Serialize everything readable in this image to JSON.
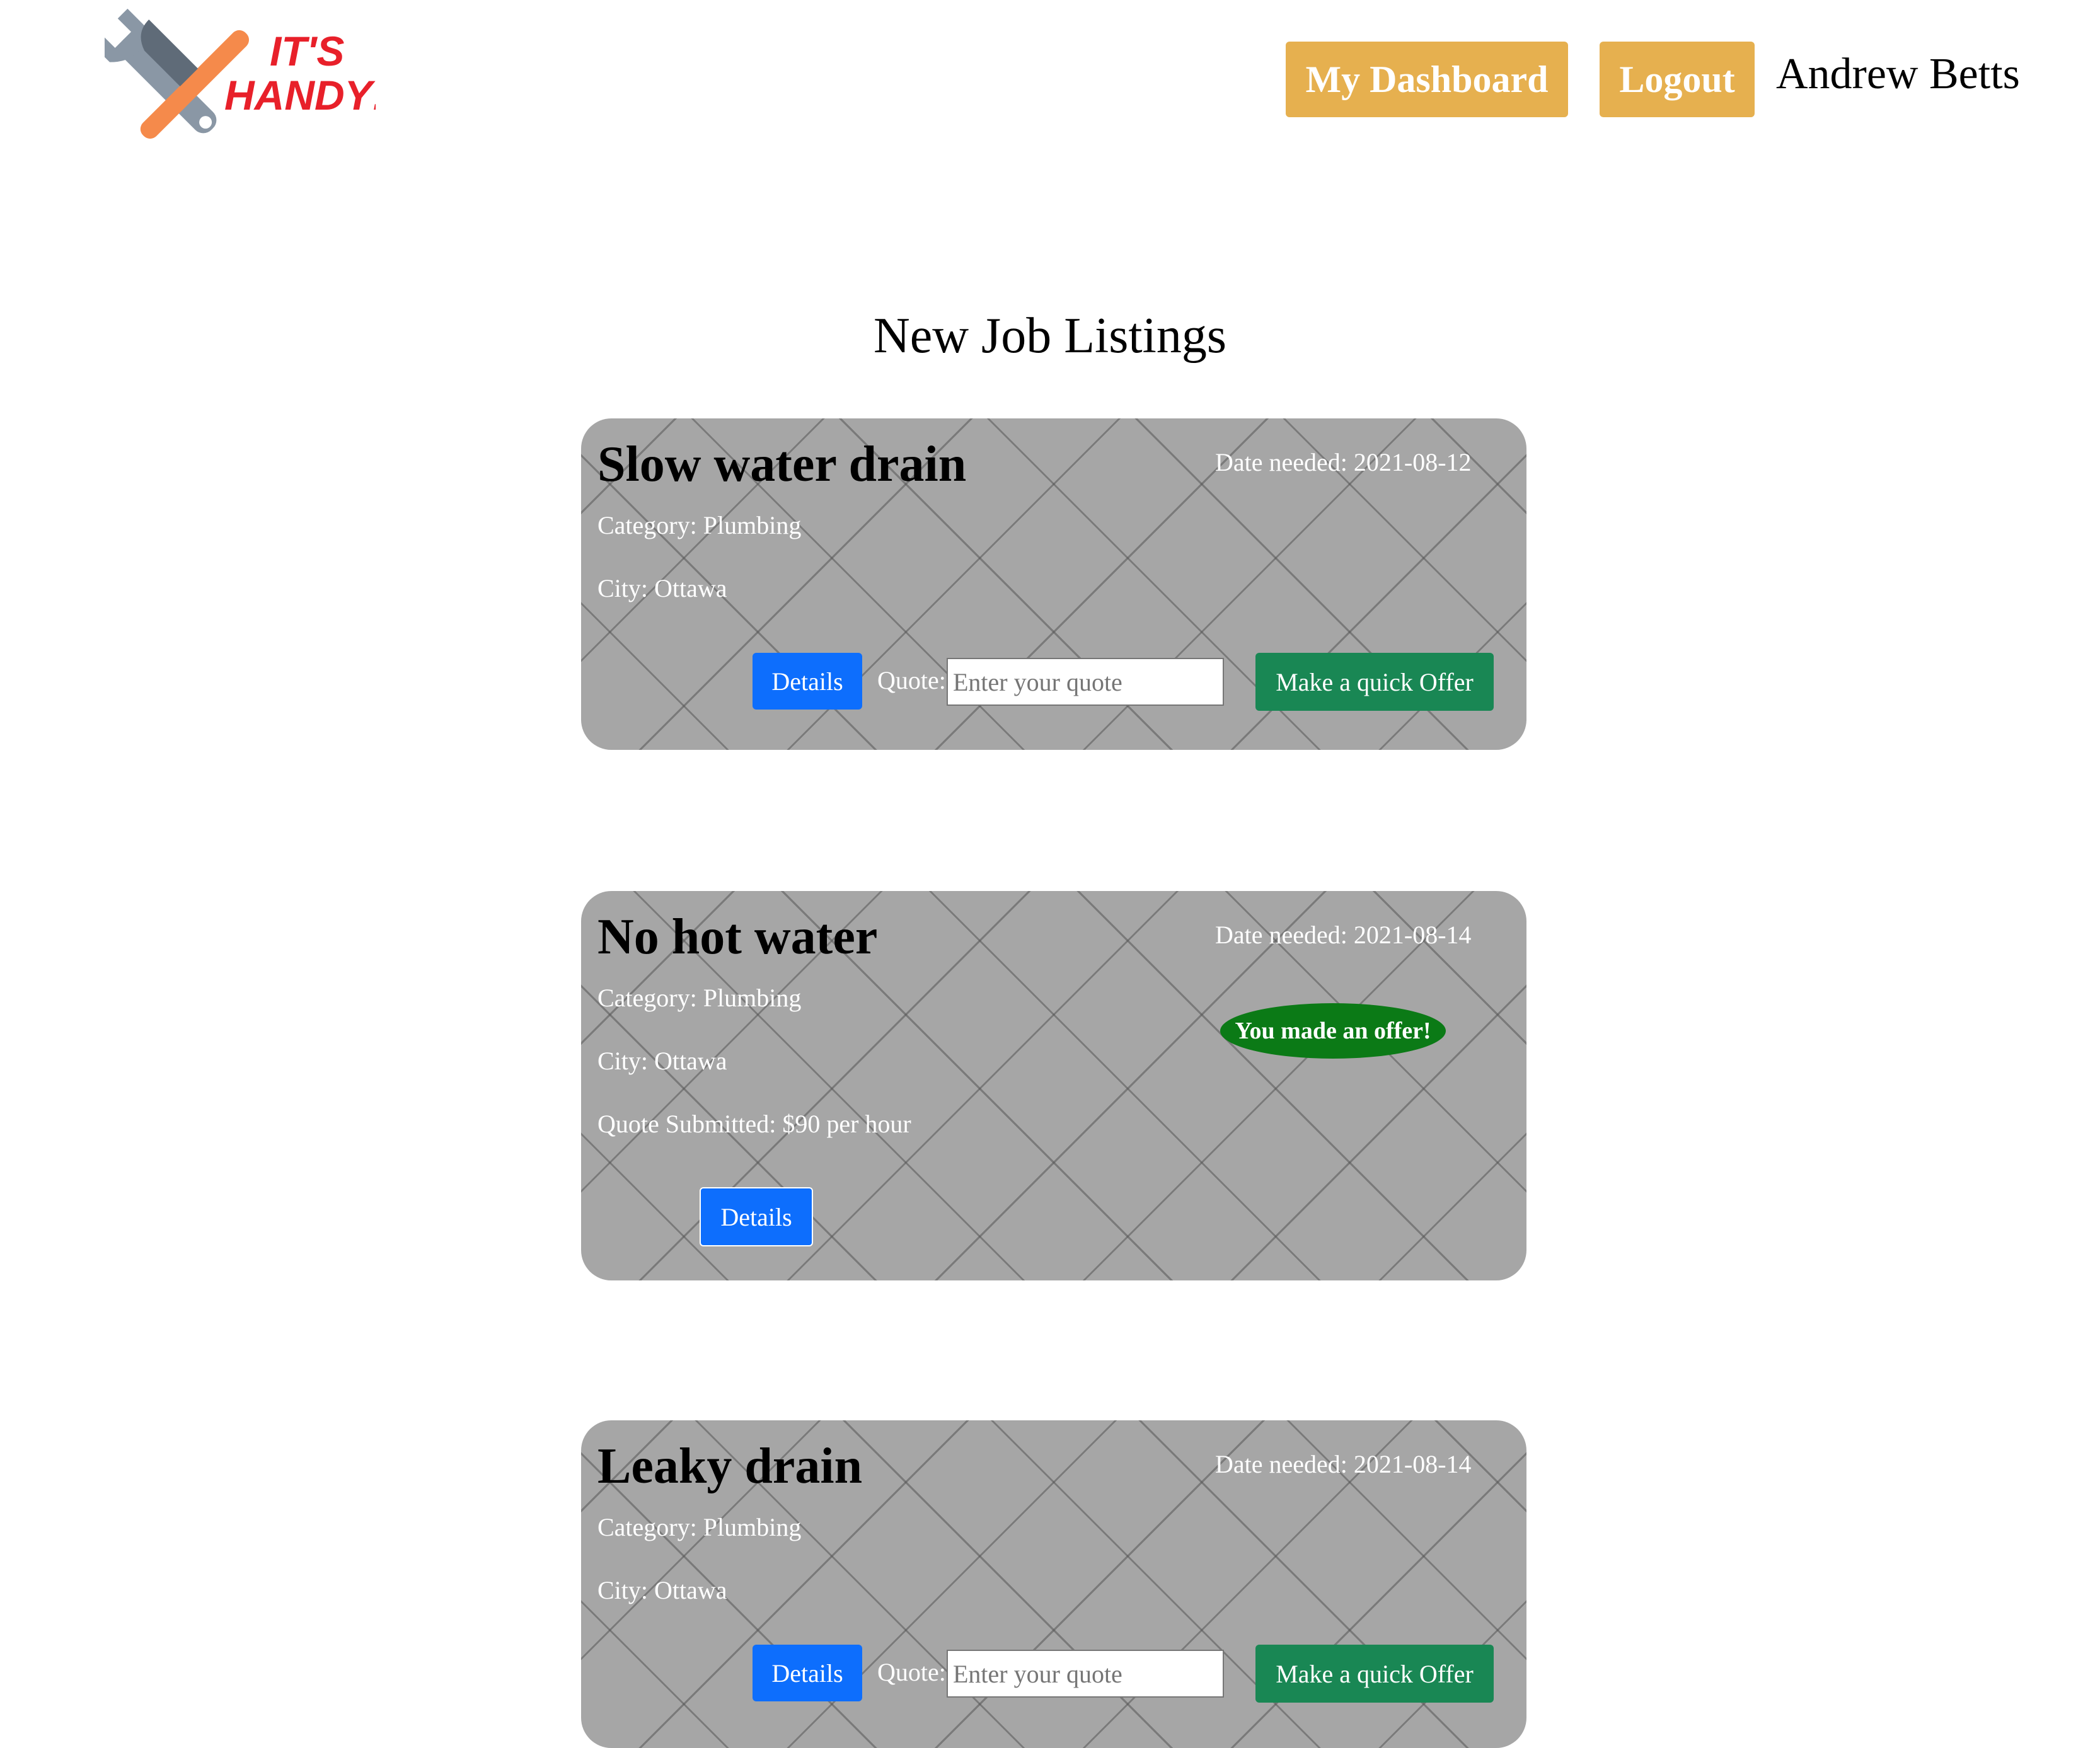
{
  "header": {
    "logo": {
      "line1": "IT'S",
      "line2": "HANDY!",
      "icon": "hammer-wrench-icon"
    },
    "dashboard_label": "My Dashboard",
    "logout_label": "Logout",
    "user_name": "Andrew Betts"
  },
  "main": {
    "title": "New Job Listings",
    "jobs": [
      {
        "title": "Slow water drain",
        "date": "Date needed: 2021-08-12",
        "category": "Category: Plumbing",
        "city": "City: Ottawa",
        "details_label": "Details",
        "quote_label": "Quote:",
        "quote_placeholder": "Enter your quote",
        "offer_label": "Make a quick Offer"
      },
      {
        "title": "No hot water",
        "date": "Date needed: 2021-08-14",
        "category": "Category: Plumbing",
        "city": "City: Ottawa",
        "quote_submitted": "Quote Submitted: $90 per hour",
        "badge": "You made an offer!",
        "details_label": "Details"
      },
      {
        "title": "Leaky drain",
        "date": "Date needed: 2021-08-14",
        "category": "Category: Plumbing",
        "city": "City: Ottawa",
        "details_label": "Details",
        "quote_label": "Quote:",
        "quote_placeholder": "Enter your quote",
        "offer_label": "Make a quick Offer"
      }
    ]
  },
  "colors": {
    "nav_button": "#e6b04f",
    "details_button": "#0d6efd",
    "offer_button": "#198754",
    "offer_badge": "#0b7a16",
    "card_background": "#a6a6a6",
    "logo_text": "#e8202a",
    "wrench": "#6c7a89",
    "hammer_handle": "#f58a4b"
  }
}
